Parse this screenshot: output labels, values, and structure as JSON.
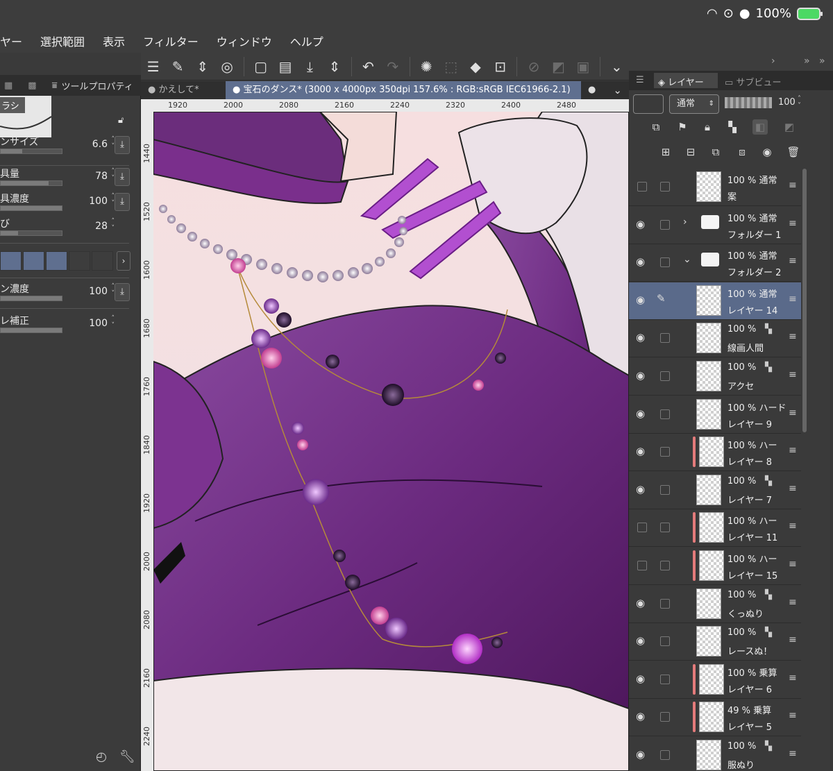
{
  "status": {
    "battery_percent": "100%"
  },
  "menubar": [
    "ヤー",
    "選択範囲",
    "表示",
    "フィルター",
    "ウィンドウ",
    "ヘルプ"
  ],
  "left_panel": {
    "tab_label": "ツールプロパティ",
    "brush_name": "ラシ",
    "props": [
      {
        "label": "ンサイズ",
        "value": "6.6",
        "level": 0.35
      },
      {
        "label": "具量",
        "value": "78",
        "level": 0.78
      },
      {
        "label": "具濃度",
        "value": "100",
        "level": 1.0
      },
      {
        "label": "び",
        "value": "28",
        "level": 0.28
      },
      {
        "label": "ン濃度",
        "value": "100",
        "level": 1.0
      },
      {
        "label": "レ補正",
        "value": "100",
        "level": 1.0
      }
    ],
    "swatch_colors": [
      "#5f6f8f",
      "#5f6f8f",
      "#5f6f8f",
      "#3d3d3d",
      "#3d3d3d"
    ]
  },
  "doc_tabs": {
    "inactive": "● かえして*",
    "active": "●  宝石のダンス* (3000 x 4000px 350dpi 157.6% : RGB:sRGB IEC61966-2.1)",
    "active_dot": "●"
  },
  "ruler": {
    "top": [
      "1920",
      "2000",
      "2080",
      "2160",
      "2240",
      "2320",
      "2400",
      "2480"
    ],
    "left": [
      "1440",
      "1520",
      "1600",
      "1680",
      "1760",
      "1840",
      "1920",
      "2000",
      "2080",
      "2160",
      "2240"
    ]
  },
  "layer_panel": {
    "tab_layer": "レイヤー",
    "tab_sub": "サブビュー",
    "blend_mode": "通常",
    "opacity": "100"
  },
  "layers": [
    {
      "pct": "100 %",
      "mode": "通常",
      "name": "案",
      "eye": false,
      "kind": "layer",
      "clip": false
    },
    {
      "pct": "100 %",
      "mode": "通常",
      "name": "フォルダー 1",
      "eye": true,
      "kind": "folder-closed",
      "clip": false
    },
    {
      "pct": "100 %",
      "mode": "通常",
      "name": "フォルダー 2",
      "eye": true,
      "kind": "folder-open",
      "clip": false
    },
    {
      "pct": "100 %",
      "mode": "通常",
      "name": "レイヤー 14",
      "eye": true,
      "kind": "layer",
      "clip": false,
      "selected": true
    },
    {
      "pct": "100 %",
      "mode": "",
      "name": "線画人間",
      "eye": true,
      "kind": "layer",
      "clip": false
    },
    {
      "pct": "100 %",
      "mode": "",
      "name": "アクセ",
      "eye": true,
      "kind": "layer",
      "clip": false
    },
    {
      "pct": "100 %",
      "mode": "ハード",
      "name": "レイヤー 9",
      "eye": true,
      "kind": "layer",
      "clip": false
    },
    {
      "pct": "100 %",
      "mode": "ハー",
      "name": "レイヤー 8",
      "eye": true,
      "kind": "layer",
      "clip": true
    },
    {
      "pct": "100 %",
      "mode": "",
      "name": "レイヤー 7",
      "eye": true,
      "kind": "layer",
      "clip": false
    },
    {
      "pct": "100 %",
      "mode": "ハー",
      "name": "レイヤー 11",
      "eye": false,
      "kind": "layer",
      "clip": true
    },
    {
      "pct": "100 %",
      "mode": "ハー",
      "name": "レイヤー 15",
      "eye": false,
      "kind": "layer",
      "clip": true
    },
    {
      "pct": "100 %",
      "mode": "",
      "name": "くっぬり",
      "eye": true,
      "kind": "layer",
      "clip": false
    },
    {
      "pct": "100 %",
      "mode": "",
      "name": "レースぬ！",
      "eye": true,
      "kind": "layer",
      "clip": false
    },
    {
      "pct": "100 %",
      "mode": "乗算",
      "name": "レイヤー 6",
      "eye": true,
      "kind": "layer",
      "clip": true
    },
    {
      "pct": "49 %",
      "mode": "乗算",
      "name": "レイヤー 5",
      "eye": true,
      "kind": "layer",
      "clip": true
    },
    {
      "pct": "100 %",
      "mode": "",
      "name": "服ぬり",
      "eye": true,
      "kind": "layer",
      "clip": false
    }
  ],
  "colors": {
    "accent": "#5f6f8f",
    "clip_marker": "#e47b7b",
    "dress": "#6b2a7f"
  }
}
